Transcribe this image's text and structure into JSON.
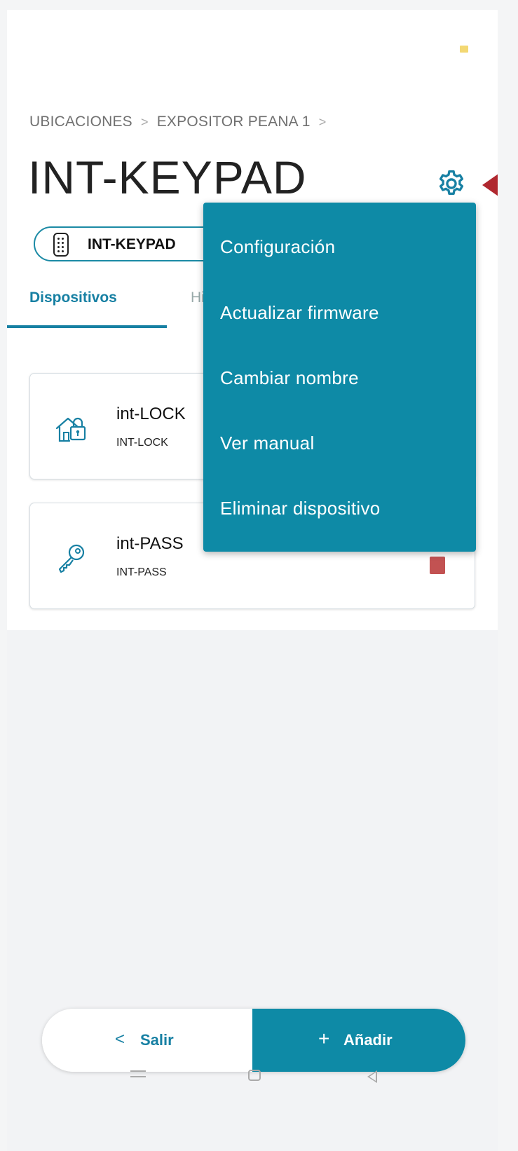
{
  "breadcrumb": {
    "items": [
      "UBICACIONES",
      "EXPOSITOR PEANA 1"
    ],
    "separator": ">"
  },
  "header": {
    "title": "INT-KEYPAD",
    "settings_icon": "gear-icon"
  },
  "chip": {
    "label": "INT-KEYPAD",
    "icon": "keypad-icon"
  },
  "tabs": [
    {
      "label": "Dispositivos",
      "active": true
    },
    {
      "label": "Hi",
      "active": false
    }
  ],
  "devices": [
    {
      "name": "int-LOCK",
      "model": "INT-LOCK",
      "icon": "house-lock-icon"
    },
    {
      "name": "int-PASS",
      "model": "INT-PASS",
      "icon": "key-icon"
    }
  ],
  "menu": {
    "items": [
      "Configuración",
      "Actualizar firmware",
      "Cambiar nombre",
      "Ver manual",
      "Eliminar dispositivo"
    ]
  },
  "bottom": {
    "exit_arrow": "<",
    "exit_label": "Salir",
    "add_plus": "+",
    "add_label": "Añadir"
  },
  "colors": {
    "accent": "#0e8aa6",
    "accent_dark": "#1780a3",
    "pointer": "#b0282f",
    "status_red": "#c25252"
  }
}
